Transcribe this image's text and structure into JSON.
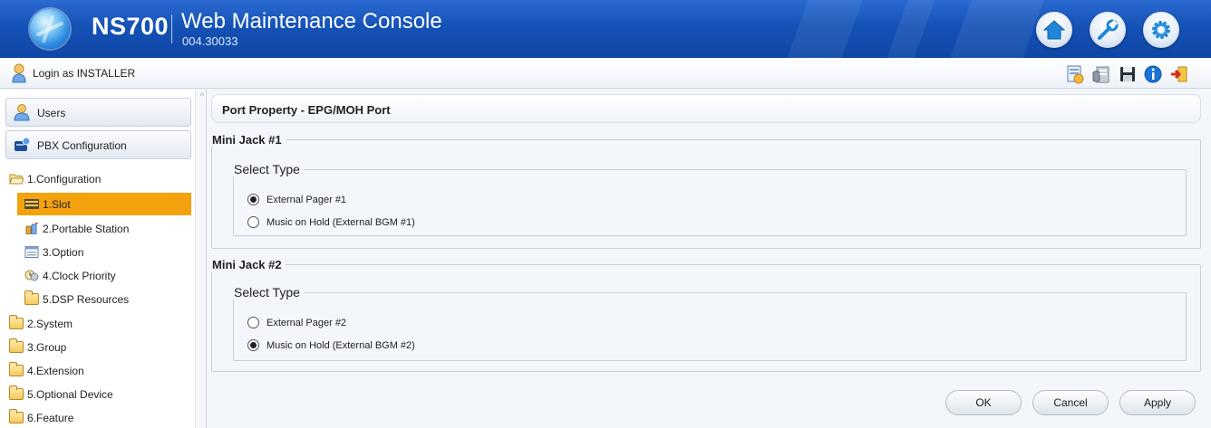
{
  "header": {
    "product": "NS700",
    "title": "Web Maintenance Console",
    "version": "004.30033",
    "buttons": [
      {
        "name": "home-icon"
      },
      {
        "name": "wrench-icon"
      },
      {
        "name": "gear-icon"
      }
    ]
  },
  "subbar": {
    "login_text": "Login as INSTALLER",
    "tools": [
      "report-icon",
      "phone-book-icon",
      "save-icon",
      "info-icon",
      "logout-icon"
    ]
  },
  "sidebar": {
    "users_label": "Users",
    "pbx_label": "PBX Configuration",
    "tree": {
      "configuration": "1.Configuration",
      "slot": "1.Slot",
      "portable_station": "2.Portable Station",
      "option": "3.Option",
      "clock_priority": "4.Clock Priority",
      "dsp_resources": "5.DSP Resources",
      "system": "2.System",
      "group": "3.Group",
      "extension": "4.Extension",
      "optional_device": "5.Optional Device",
      "feature": "6.Feature"
    }
  },
  "main": {
    "page_title": "Port Property - EPG/MOH Port",
    "jack1": {
      "title": "Mini Jack #1",
      "select_type": "Select Type",
      "option1": "External Pager #1",
      "option2": "Music on Hold (External BGM #1)",
      "selected": "option1"
    },
    "jack2": {
      "title": "Mini Jack #2",
      "select_type": "Select Type",
      "option1": "External Pager #2",
      "option2": "Music on Hold (External BGM #2)",
      "selected": "option2"
    },
    "buttons": {
      "ok": "OK",
      "cancel": "Cancel",
      "apply": "Apply"
    }
  },
  "colors": {
    "header_blue": "#1552b6",
    "selected_orange": "#f4a30e"
  }
}
